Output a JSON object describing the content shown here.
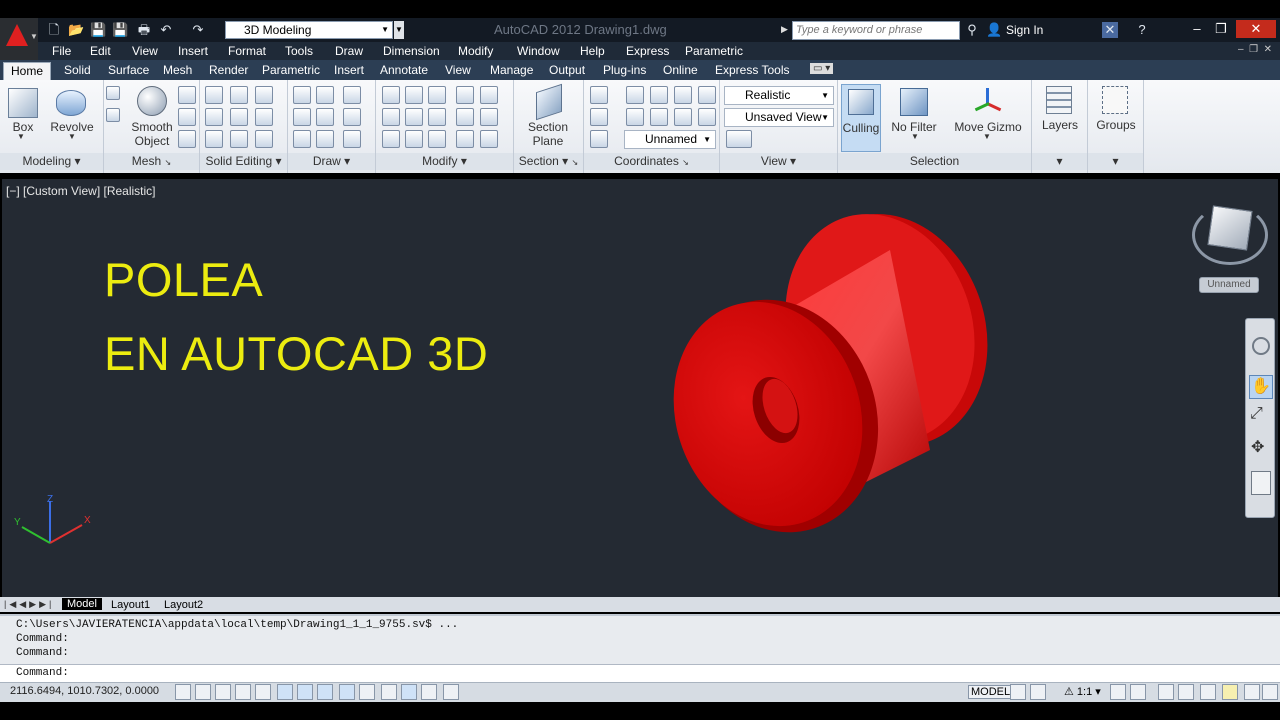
{
  "window": {
    "workspace": "3D Modeling",
    "title": "AutoCAD 2012    Drawing1.dwg",
    "search_placeholder": "Type a keyword or phrase",
    "sign_in": "Sign In"
  },
  "menus": [
    "File",
    "Edit",
    "View",
    "Insert",
    "Format",
    "Tools",
    "Draw",
    "Dimension",
    "Modify",
    "Window",
    "Help",
    "Express",
    "Parametric"
  ],
  "tabs": [
    "Home",
    "Solid",
    "Surface",
    "Mesh",
    "Render",
    "Parametric",
    "Insert",
    "Annotate",
    "View",
    "Manage",
    "Output",
    "Plug-ins",
    "Online",
    "Express Tools"
  ],
  "ribbon": {
    "box": "Box",
    "revolve": "Revolve",
    "smooth_object": "Smooth Object",
    "section_plane": "Section Plane",
    "visual_style": "Realistic",
    "saved_view": "Unsaved View",
    "ucs_name": "Unnamed",
    "culling": "Culling",
    "no_filter": "No Filter",
    "move_gizmo": "Move Gizmo",
    "layers": "Layers",
    "groups": "Groups",
    "panels": {
      "modeling": "Modeling",
      "mesh": "Mesh",
      "solid_editing": "Solid Editing",
      "draw": "Draw",
      "modify": "Modify",
      "section": "Section",
      "coordinates": "Coordinates",
      "view": "View",
      "selection": "Selection"
    }
  },
  "viewport": {
    "label": "[−] [Custom View] [Realistic]",
    "title_line1": "POLEA",
    "title_line2": "EN AUTOCAD 3D",
    "viewcube_label": "Unnamed",
    "text_color": "#ecec10",
    "model_color": "#e01010"
  },
  "layout_tabs": [
    "Model",
    "Layout1",
    "Layout2"
  ],
  "command": {
    "history": [
      "C:\\Users\\JAVIERATENCIA\\appdata\\local\\temp\\Drawing1_1_1_9755.sv$ ...",
      "Command:",
      "Command:"
    ],
    "prompt": "Command:"
  },
  "status": {
    "coords": "2116.6494, 1010.7302, 0.0000",
    "model": "MODEL",
    "scale": "1:1"
  }
}
